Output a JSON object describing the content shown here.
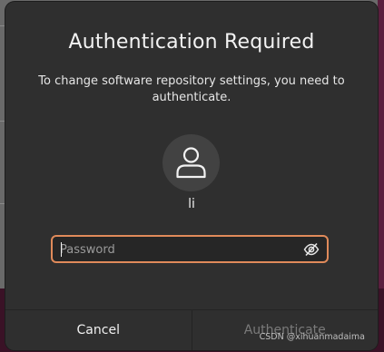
{
  "dialog": {
    "title": "Authentication Required",
    "message": "To change software repository settings, you need to authenticate.",
    "username": "li",
    "password_placeholder": "Password",
    "password_value": "",
    "cancel_label": "Cancel",
    "authenticate_label": "Authenticate",
    "authenticate_enabled": false
  },
  "icons": {
    "avatar": "user-icon",
    "password_visibility": "eye-slash-icon"
  },
  "colors": {
    "dialog_bg": "#2f2f2f",
    "focus_border": "#e08a5a",
    "text": "#f3f3f3",
    "disabled_text": "#7a7a7a"
  },
  "watermark": "CSDN @xihuanmadaima"
}
